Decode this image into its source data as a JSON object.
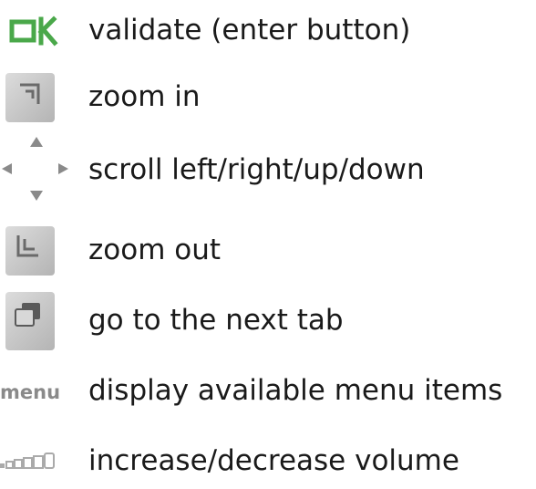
{
  "legend": {
    "items": [
      {
        "icon": "ok-icon",
        "icon_text": "OK",
        "label": "validate (enter button)"
      },
      {
        "icon": "zoom-in-icon",
        "label": "zoom in"
      },
      {
        "icon": "scroll-arrows-icon",
        "label": "scroll left/right/up/down"
      },
      {
        "icon": "zoom-out-icon",
        "label": "zoom out"
      },
      {
        "icon": "next-tab-icon",
        "label": "go to the next tab"
      },
      {
        "icon": "menu-icon",
        "icon_text": "menu",
        "label": "display available menu items"
      },
      {
        "icon": "volume-icon",
        "label": "increase/decrease volume"
      }
    ]
  },
  "colors": {
    "ok_green": "#4aa84a",
    "icon_gray": "#8a8a8a",
    "text": "#1a1a1a"
  }
}
